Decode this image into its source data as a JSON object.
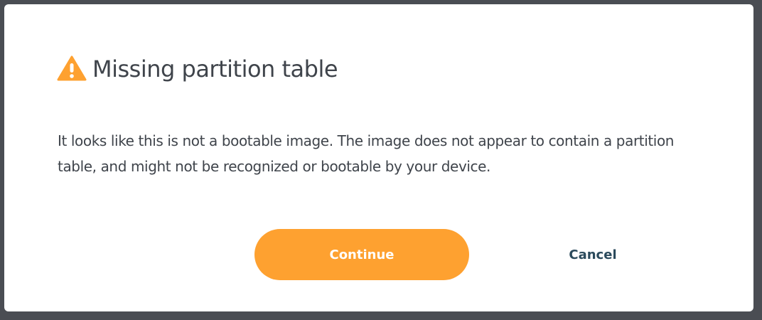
{
  "dialog": {
    "title": "Missing partition table",
    "icon": "warning-icon",
    "message": "It looks like this is not a bootable image. The image does not appear to contain a partition table, and might not be recognized or bootable by your device.",
    "buttons": {
      "continue_label": "Continue",
      "cancel_label": "Cancel"
    }
  },
  "colors": {
    "accent": "#fea130",
    "text": "#3f444b",
    "cancel_text": "#2b4a5c",
    "backdrop": "#4a4d53"
  }
}
